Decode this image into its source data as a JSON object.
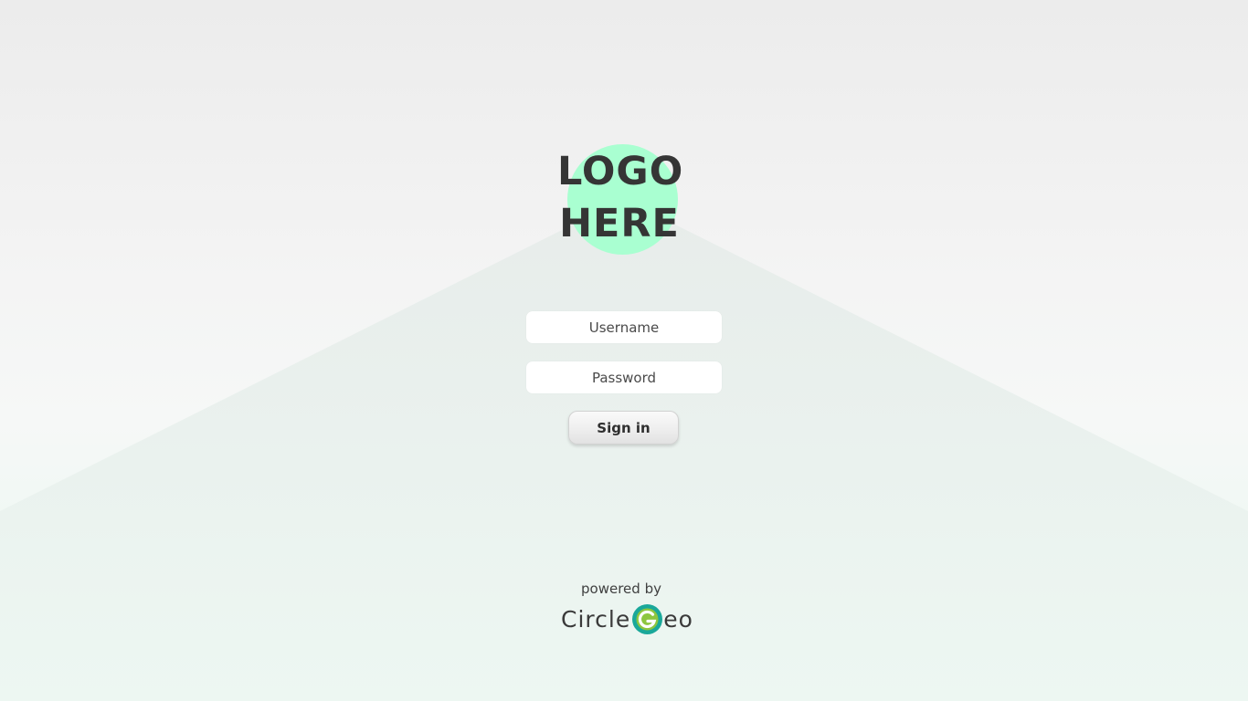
{
  "logo": {
    "line1": "LOGO",
    "line2": "HERE"
  },
  "form": {
    "username_placeholder": "Username",
    "password_placeholder": "Password",
    "signin_label": "Sign in"
  },
  "footer": {
    "powered_by": "powered by",
    "brand_prefix": "Circle",
    "brand_suffix": "eo",
    "brand_icon": "circlegeo-g-icon"
  },
  "colors": {
    "logo_circle": "#a9ffd1",
    "brand_green": "#8dc63f",
    "brand_teal": "#1aa89a",
    "text_dark": "#353535"
  }
}
